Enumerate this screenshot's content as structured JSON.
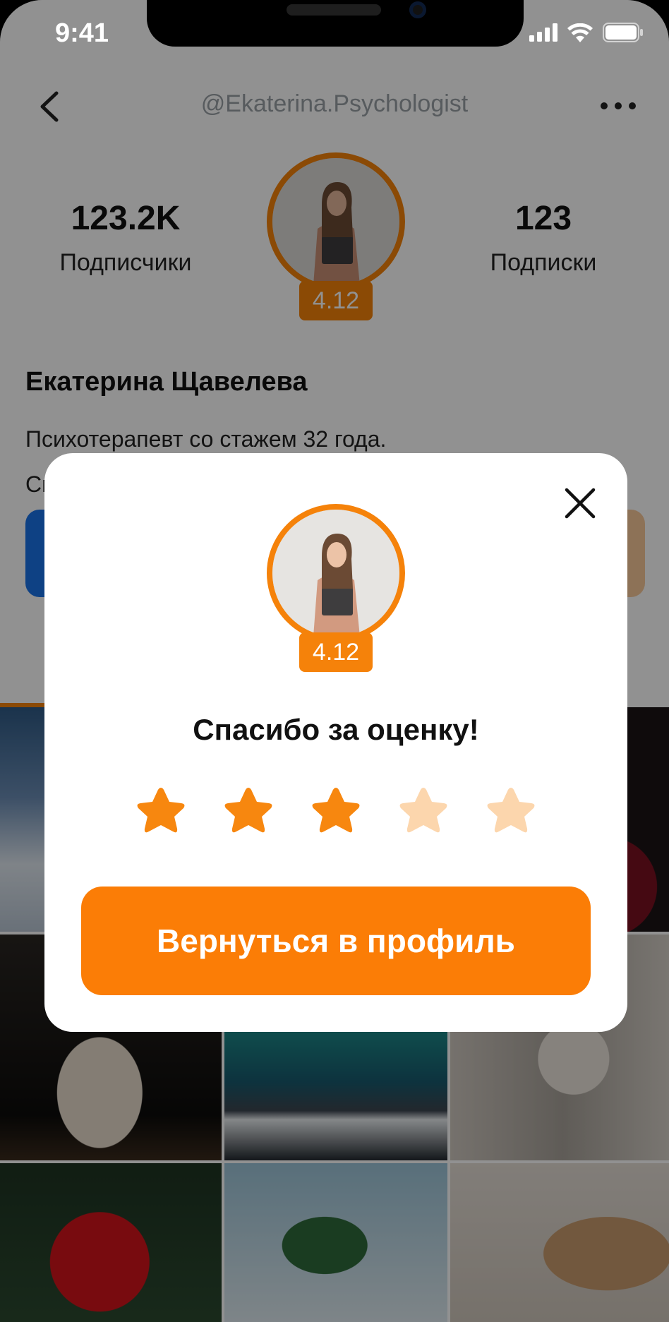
{
  "status_bar": {
    "time": "9:41"
  },
  "header": {
    "handle": "@Ekaterina.Psychologist"
  },
  "stats": {
    "followers_count": "123.2K",
    "followers_label": "Подписчики",
    "following_count": "123",
    "following_label": "Подписки"
  },
  "profile": {
    "rating": "4.12",
    "name": "Екатерина Щавелева",
    "bio_line1": "Психотерапевт со стажем 32 года.",
    "bio_line2": "Сп"
  },
  "modal": {
    "rating": "4.12",
    "title": "Спасибо за оценку!",
    "stars_selected": 3,
    "stars_total": 5,
    "cta_label": "Вернуться в профиль"
  },
  "colors": {
    "accent": "#f5820a",
    "cta": "#fb7d06",
    "star_filled": "#f7870f",
    "star_empty": "#fcd6ad",
    "overlay": "rgba(0,0,0,0.43)"
  }
}
